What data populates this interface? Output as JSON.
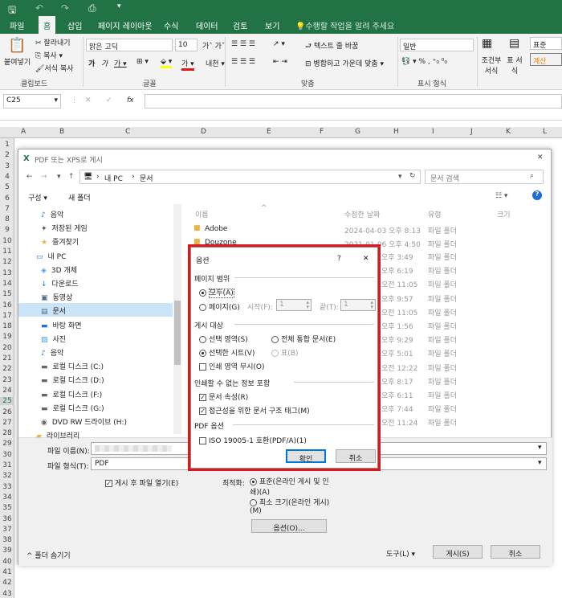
{
  "ribbon_tabs": [
    "파일",
    "홈",
    "삽입",
    "페이지 레이아웃",
    "수식",
    "데이터",
    "검토",
    "보기"
  ],
  "tell_me": "수행할 작업을 알려 주세요",
  "clipboard": {
    "paste": "붙여넣기",
    "cut": "잘라내기",
    "copy": "복사",
    "format_painter": "서식 복사",
    "group": "클립보드"
  },
  "font": {
    "name": "맑은 고딕",
    "size": "10",
    "group": "글꼴"
  },
  "alignment": {
    "wrap": "텍스트 줄 바꿈",
    "merge": "병합하고 가운데 맞춤",
    "group": "맞춤"
  },
  "number": {
    "format": "일반",
    "group": "표시 형식"
  },
  "styles": {
    "conditional": "조건부 서식",
    "table": "표 서식",
    "normal": "표준",
    "calc": "계산"
  },
  "name_box": "C25",
  "formula_fx": "fx",
  "columns": [
    "A",
    "B",
    "C",
    "D",
    "E",
    "F",
    "G",
    "H",
    "I",
    "J",
    "K",
    "L"
  ],
  "rows": [
    "1",
    "2",
    "3",
    "4",
    "5",
    "6",
    "7",
    "8",
    "9",
    "10",
    "11",
    "12",
    "13",
    "14",
    "15",
    "16",
    "17",
    "18",
    "19",
    "20",
    "21",
    "22",
    "23",
    "24",
    "25",
    "26",
    "27",
    "28",
    "29",
    "30",
    "31",
    "32",
    "33",
    "34",
    "35",
    "36",
    "37",
    "38",
    "39",
    "40",
    "41",
    "42",
    "43"
  ],
  "file_dialog": {
    "title": "PDF 또는 XPS로 게시",
    "path_pc": "내 PC",
    "path_docs": "문서",
    "search_placeholder": "문서 검색",
    "organize": "구성 ▾",
    "new_folder": "새 폴더",
    "nav": [
      "음악",
      "저장된 게임",
      "즐겨찾기",
      "내 PC",
      "3D 개체",
      "다운로드",
      "동영상",
      "문서",
      "바탕 화면",
      "사진",
      "음악",
      "로컬 디스크 (C:)",
      "로컬 디스크 (D:)",
      "로컬 디스크 (F:)",
      "로컬 디스크 (G:)",
      "DVD RW 드라이브 (H:)",
      "라이브러리"
    ],
    "col_name": "이름",
    "col_date": "수정한 날짜",
    "col_type": "유형",
    "col_size": "크기",
    "files": [
      {
        "name": "Adobe",
        "date": "2024-04-03 오후 8:13",
        "type": "파일 폴더"
      },
      {
        "name": "Douzone",
        "date": "2021-01-06 오후 4:50",
        "type": "파일 폴더"
      }
    ],
    "extra_dates": [
      "오후 3:49",
      "오후 6:19",
      "오전 11:05",
      "오후 9:57",
      "오전 11:05",
      "오후 1:56",
      "오후 9:29",
      "오후 5:01",
      "오전 12:22",
      "오후 8:17",
      "오후 6:11",
      "오후 7:44",
      "오전 11:24"
    ],
    "extra_type": "파일 폴더",
    "filename_label": "파일 이름(N):",
    "filetype_label": "파일 형식(T):",
    "filetype_value": "PDF",
    "open_after": "게시 후 파일 열기(E)",
    "optimize_label": "최적화:",
    "opt_standard": "표준(온라인 게시 및 인쇄)(A)",
    "opt_minimum": "최소 크기(온라인 게시)(M)",
    "options_btn": "옵션(O)...",
    "hide_folders": "폴더 숨기기",
    "tools": "도구(L)",
    "publish": "게시(S)",
    "cancel": "취소"
  },
  "options": {
    "title": "옵션",
    "help": "?",
    "close": "✕",
    "range_group": "페이지 범위",
    "all": "모두(A)",
    "pages": "페이지(G)",
    "from": "시작(F):",
    "from_val": "1",
    "to": "끝(T):",
    "to_val": "1",
    "publish_group": "게시 대상",
    "selection": "선택 영역(S)",
    "entire": "전체 통합 문서(E)",
    "active_sheet": "선택한 시트(V)",
    "table": "표(B)",
    "ignore_print": "인쇄 영역 무시(O)",
    "nonprint_group": "인쇄할 수 없는 정보 포함",
    "doc_props": "문서 속성(R)",
    "struct_tags": "접근성을 위한 문서 구조 태그(M)",
    "pdf_group": "PDF 옵션",
    "iso": "ISO 19005-1 호환(PDF/A)(1)",
    "ok": "확인",
    "cancel": "취소"
  }
}
